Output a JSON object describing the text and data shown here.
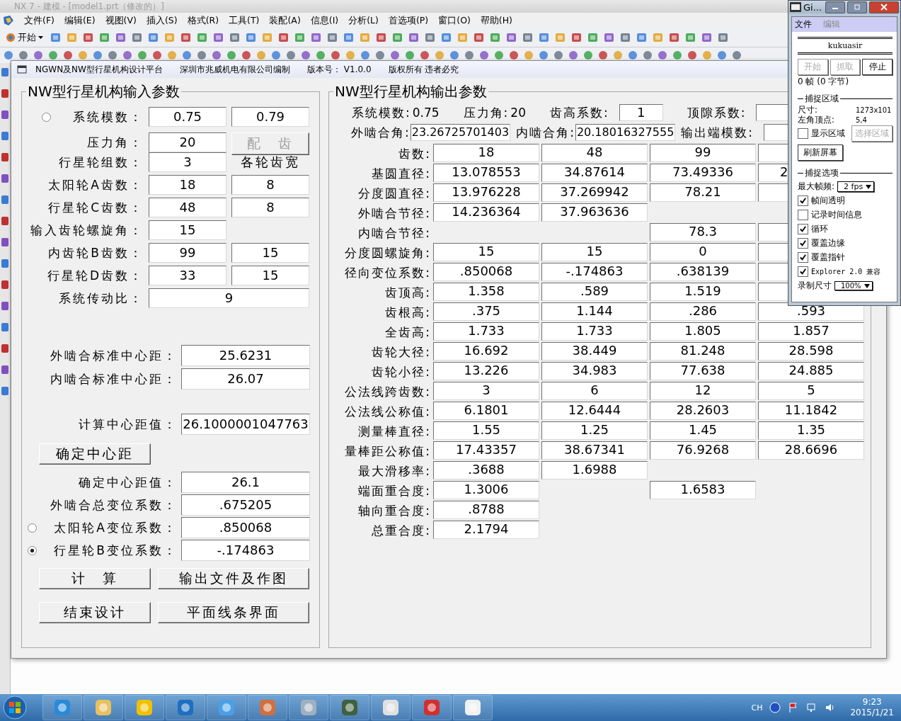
{
  "app_window": {
    "title": "NX 7 - 建模 - [model1.prt（修改的）]"
  },
  "menu": [
    "文件(F)",
    "编辑(E)",
    "视图(V)",
    "插入(S)",
    "格式(R)",
    "工具(T)",
    "装配(A)",
    "信息(I)",
    "分析(L)",
    "首选项(P)",
    "窗口(O)",
    "帮助(H)"
  ],
  "toolbar": {
    "start_label": "开始"
  },
  "dialog": {
    "title_parts": [
      "NGWN及NW型行星机构设计平台",
      "深圳市兆威机电有限公司编制",
      "版本号： V1.0.0",
      "版权所有  违者必究"
    ]
  },
  "input_panel": {
    "title": "NW型行星机构输入参数",
    "rows": [
      {
        "label": "系统模数：",
        "radio": {
          "selected": false
        },
        "cells": [
          {
            "kind": "field",
            "value": "0.75"
          },
          {
            "kind": "field",
            "value": "0.79"
          }
        ]
      },
      {
        "label": "压力角：",
        "cells": [
          {
            "kind": "field",
            "value": "20"
          },
          {
            "kind": "button",
            "label": "配　齿",
            "disabled": true
          }
        ]
      },
      {
        "label": "行星轮组数：",
        "cells": [
          {
            "kind": "field",
            "value": "3"
          },
          {
            "kind": "caption",
            "text": "各轮齿宽"
          }
        ]
      },
      {
        "label": "太阳轮A齿数：",
        "cells": [
          {
            "kind": "field",
            "value": "18"
          },
          {
            "kind": "field",
            "value": "8"
          }
        ]
      },
      {
        "label": "行星轮C齿数：",
        "cells": [
          {
            "kind": "field",
            "value": "48"
          },
          {
            "kind": "field",
            "value": "8"
          }
        ]
      },
      {
        "label": "输入齿轮螺旋角：",
        "cells": [
          {
            "kind": "field",
            "value": "15"
          }
        ]
      },
      {
        "label": "内齿轮B齿数：",
        "cells": [
          {
            "kind": "field",
            "value": "99"
          },
          {
            "kind": "field",
            "value": "15"
          }
        ]
      },
      {
        "label": "行星轮D齿数：",
        "cells": [
          {
            "kind": "field",
            "value": "33"
          },
          {
            "kind": "field",
            "value": "15"
          }
        ]
      },
      {
        "label": "系统传动比：",
        "cells": [
          {
            "kind": "wide",
            "value": "9"
          }
        ]
      }
    ],
    "standard_rows": [
      {
        "label": "外啮合标准中心距：",
        "value": "25.6231"
      },
      {
        "label": "内啮合标准中心距：",
        "value": "26.07"
      }
    ],
    "calc_row": {
      "label": "计算中心距值：",
      "value": "26.1000001047763"
    },
    "confirm_button": "确定中心距",
    "result_rows": [
      {
        "label": "确定中心距值：",
        "value": "26.1"
      },
      {
        "label": "外啮合总变位系数：",
        "value": ".675205"
      },
      {
        "label": "太阳轮A变位系数：",
        "value": ".850068",
        "radio": {
          "selected": false
        }
      },
      {
        "label": "行星轮B变位系数：",
        "value": "-.174863",
        "radio": {
          "selected": true
        }
      }
    ],
    "action_buttons": [
      "计　算",
      "输出文件及作图",
      "结束设计",
      "平面线条界面"
    ]
  },
  "output_panel": {
    "title": "NW型行星机构输出参数",
    "info_lines": [
      [
        {
          "kind": "text",
          "label": "系统模数:",
          "value": "0.75"
        },
        {
          "kind": "text",
          "label": "压力角:",
          "value": "20"
        },
        {
          "kind": "field",
          "label": "齿高系数:",
          "value": "1"
        },
        {
          "kind": "field",
          "label": "顶隙系数:"
        }
      ],
      [
        {
          "kind": "wide-field",
          "label": "外啮合角:",
          "value": "23.26725701403"
        },
        {
          "kind": "wide-field",
          "label": "内啮合角:",
          "value": "20.18016327555"
        },
        {
          "kind": "field",
          "label": "输出端模数:"
        }
      ]
    ],
    "rows": [
      {
        "label": "齿数:",
        "cells": [
          {
            "kind": "value",
            "text": "18"
          },
          {
            "kind": "value",
            "text": "48"
          },
          {
            "kind": "value",
            "text": "99"
          },
          {
            "kind": "empty"
          }
        ]
      },
      {
        "label": "基圆直径:",
        "cells": [
          {
            "kind": "value",
            "text": "13.078553"
          },
          {
            "kind": "value",
            "text": "34.87614"
          },
          {
            "kind": "value",
            "text": "73.49336"
          },
          {
            "kind": "partial",
            "text": "2"
          }
        ]
      },
      {
        "label": "分度圆直径:",
        "cells": [
          {
            "kind": "value",
            "text": "13.976228"
          },
          {
            "kind": "value",
            "text": "37.269942"
          },
          {
            "kind": "value",
            "text": "78.21"
          },
          {
            "kind": "empty"
          }
        ]
      },
      {
        "label": "外啮合节径:",
        "cells": [
          {
            "kind": "value",
            "text": "14.236364"
          },
          {
            "kind": "value",
            "text": "37.963636"
          },
          null,
          null
        ]
      },
      {
        "label": "内啮合节径:",
        "cells": [
          null,
          null,
          {
            "kind": "value",
            "text": "78.3"
          },
          {
            "kind": "empty"
          }
        ]
      },
      {
        "label": "分度圆螺旋角:",
        "cells": [
          {
            "kind": "value",
            "text": "15"
          },
          {
            "kind": "value",
            "text": "15"
          },
          {
            "kind": "value",
            "text": "0"
          },
          {
            "kind": "empty"
          }
        ]
      },
      {
        "label": "径向变位系数:",
        "cells": [
          {
            "kind": "value",
            "text": ".850068"
          },
          {
            "kind": "value",
            "text": "-.174863"
          },
          {
            "kind": "value",
            "text": ".638139"
          },
          {
            "kind": "empty"
          }
        ]
      },
      {
        "label": "齿顶高:",
        "cells": [
          {
            "kind": "value",
            "text": "1.358"
          },
          {
            "kind": "value",
            "text": ".589"
          },
          {
            "kind": "value",
            "text": "1.519"
          },
          {
            "kind": "empty"
          }
        ]
      },
      {
        "label": "齿根高:",
        "cells": [
          {
            "kind": "value",
            "text": ".375"
          },
          {
            "kind": "value",
            "text": "1.144"
          },
          {
            "kind": "value",
            "text": ".286"
          },
          {
            "kind": "value",
            "text": ".593"
          }
        ]
      },
      {
        "label": "全齿高:",
        "cells": [
          {
            "kind": "value",
            "text": "1.733"
          },
          {
            "kind": "value",
            "text": "1.733"
          },
          {
            "kind": "value",
            "text": "1.805"
          },
          {
            "kind": "value",
            "text": "1.857"
          }
        ]
      },
      {
        "label": "齿轮大径:",
        "cells": [
          {
            "kind": "value",
            "text": "16.692"
          },
          {
            "kind": "value",
            "text": "38.449"
          },
          {
            "kind": "value",
            "text": "81.248"
          },
          {
            "kind": "value",
            "text": "28.598"
          }
        ]
      },
      {
        "label": "齿轮小径:",
        "cells": [
          {
            "kind": "value",
            "text": "13.226"
          },
          {
            "kind": "value",
            "text": "34.983"
          },
          {
            "kind": "value",
            "text": "77.638"
          },
          {
            "kind": "value",
            "text": "24.885"
          }
        ]
      },
      {
        "label": "公法线跨齿数:",
        "cells": [
          {
            "kind": "value",
            "text": "3"
          },
          {
            "kind": "value",
            "text": "6"
          },
          {
            "kind": "value",
            "text": "12"
          },
          {
            "kind": "value",
            "text": "5"
          }
        ]
      },
      {
        "label": "公法线公称值:",
        "cells": [
          {
            "kind": "value",
            "text": "6.1801"
          },
          {
            "kind": "value",
            "text": "12.6444"
          },
          {
            "kind": "value",
            "text": "28.2603"
          },
          {
            "kind": "value",
            "text": "11.1842"
          }
        ]
      },
      {
        "label": "测量棒直径:",
        "cells": [
          {
            "kind": "value",
            "text": "1.55"
          },
          {
            "kind": "value",
            "text": "1.25"
          },
          {
            "kind": "value",
            "text": "1.45"
          },
          {
            "kind": "value",
            "text": "1.35"
          }
        ]
      },
      {
        "label": "量棒距公称值:",
        "cells": [
          {
            "kind": "value",
            "text": "17.43357"
          },
          {
            "kind": "value",
            "text": "38.67341"
          },
          {
            "kind": "value",
            "text": "76.9268"
          },
          {
            "kind": "value",
            "text": "28.6696"
          }
        ]
      },
      {
        "label": "最大滑移率:",
        "cells": [
          {
            "kind": "value",
            "text": ".3688"
          },
          {
            "kind": "value",
            "text": "1.6988"
          },
          null,
          null
        ]
      },
      {
        "label": "端面重合度:",
        "cells": [
          {
            "kind": "value",
            "text": "1.3006"
          },
          null,
          {
            "kind": "value",
            "text": "1.6583"
          },
          null
        ]
      },
      {
        "label": "轴向重合度:",
        "cells": [
          {
            "kind": "value",
            "text": ".8788"
          },
          null,
          null,
          null
        ]
      },
      {
        "label": "总重合度:",
        "cells": [
          {
            "kind": "value",
            "text": "2.1794"
          },
          null,
          null,
          null
        ]
      }
    ]
  },
  "recorder": {
    "title": "Gi...",
    "menu": [
      {
        "label": "文件",
        "disabled": false
      },
      {
        "label": "编辑",
        "disabled": true
      }
    ],
    "name": "kukuasir",
    "buttons": [
      {
        "label": "开始",
        "disabled": true
      },
      {
        "label": "抓取",
        "disabled": true
      },
      {
        "label": "停止",
        "disabled": false
      }
    ],
    "status": "0 帧 (0 字节)",
    "area_title": "捕捉区域",
    "size_label": "尺寸:",
    "size_value": "1273x101",
    "corner_label": "左角顶点:",
    "corner_value": "5,4",
    "show_area": {
      "label": "显示区域",
      "checked": false
    },
    "select_button": {
      "label": "选择区域",
      "disabled": true
    },
    "refresh_button": "刷新屏幕",
    "options_title": "捕捉选项",
    "fps_label": "最大帧频:",
    "fps_value": "2 fps",
    "options": [
      {
        "label": "帧间透明",
        "checked": true
      },
      {
        "label": "记录时间信息",
        "checked": false
      },
      {
        "label": "循环",
        "checked": true
      },
      {
        "label": "覆盖边缘",
        "checked": true
      },
      {
        "label": "覆盖指针",
        "checked": true
      },
      {
        "label": "Explorer 2.0 兼容",
        "checked": true
      }
    ],
    "rec_size_label": "录制尺寸",
    "rec_size_value": "100%"
  },
  "taskbar": {
    "lang": "CH",
    "time": "9:23",
    "date": "2015/1/21"
  }
}
